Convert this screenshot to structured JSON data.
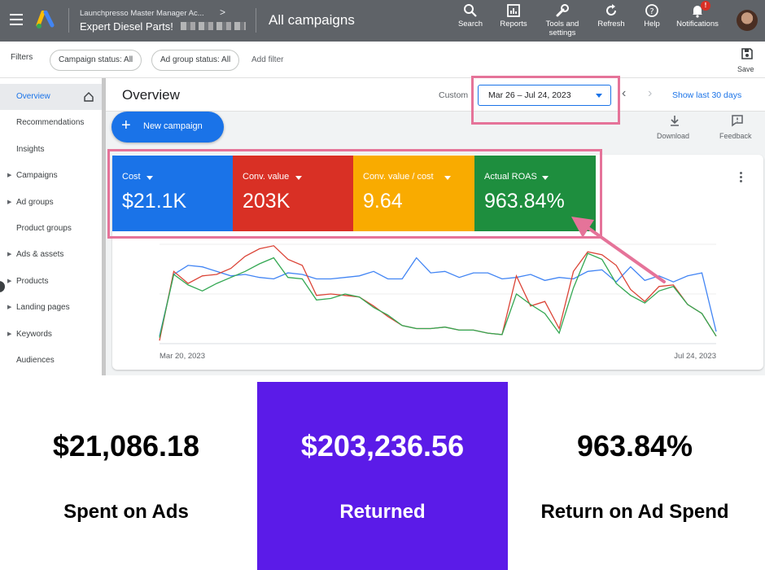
{
  "topbar": {
    "account_path": "Launchpresso Master Manager Ac...",
    "account_name": "Expert Diesel Parts!",
    "page_title": "All campaigns",
    "tools": [
      {
        "icon": "search-icon",
        "label": "Search"
      },
      {
        "icon": "reports-icon",
        "label": "Reports"
      },
      {
        "icon": "wrench-icon",
        "label": "Tools and\nsettings"
      },
      {
        "icon": "refresh-icon",
        "label": "Refresh"
      },
      {
        "icon": "help-icon",
        "label": "Help"
      },
      {
        "icon": "bell-icon",
        "label": "Notifications"
      }
    ],
    "notification_badge": "!"
  },
  "filters": {
    "label": "Filters",
    "campaign_status": "Campaign status: All",
    "ad_group_status": "Ad group status: All",
    "add_filter": "Add filter",
    "save_label": "Save"
  },
  "sidebar": {
    "items": [
      {
        "label": "Overview",
        "active": true,
        "caret": false
      },
      {
        "label": "Recommendations",
        "active": false,
        "caret": false
      },
      {
        "label": "Insights",
        "active": false,
        "caret": false
      },
      {
        "label": "Campaigns",
        "active": false,
        "caret": true
      },
      {
        "label": "Ad groups",
        "active": false,
        "caret": true
      },
      {
        "label": "Product groups",
        "active": false,
        "caret": false
      },
      {
        "label": "Ads & assets",
        "active": false,
        "caret": true
      },
      {
        "label": "Products",
        "active": false,
        "caret": true
      },
      {
        "label": "Landing pages",
        "active": false,
        "caret": true
      },
      {
        "label": "Keywords",
        "active": false,
        "caret": true
      },
      {
        "label": "Audiences",
        "active": false,
        "caret": false
      }
    ]
  },
  "overview": {
    "title": "Overview",
    "custom_label": "Custom",
    "date_range": "Mar 26 – Jul 24, 2023",
    "show_last": "Show last 30 days",
    "new_campaign": "New campaign",
    "download": "Download",
    "feedback": "Feedback"
  },
  "kpis": [
    {
      "label": "Cost",
      "value": "$21.1K",
      "color": "#1a73e8"
    },
    {
      "label": "Conv. value",
      "value": "203K",
      "color": "#d93025"
    },
    {
      "label": "Conv. value / cost",
      "value": "9.64",
      "color": "#f9ab00"
    },
    {
      "label": "Actual ROAS",
      "value": "963.84%",
      "color": "#1e8e3e"
    }
  ],
  "highlight_color": "#e57399",
  "chart_data": {
    "type": "line",
    "x_start_label": "Mar 20, 2023",
    "x_end_label": "Jul 24, 2023",
    "series": [
      {
        "color": "#4285f4",
        "values": [
          5,
          46,
          52,
          51,
          48,
          45,
          46,
          44,
          43,
          47,
          46,
          43,
          43,
          44,
          45,
          48,
          43,
          43,
          57,
          47,
          48,
          44,
          47,
          47,
          43,
          44,
          46,
          42,
          44,
          43,
          48,
          49,
          41,
          51,
          42,
          45,
          41,
          45,
          47,
          8
        ]
      },
      {
        "color": "#db4437",
        "values": [
          2,
          48,
          40,
          45,
          46,
          50,
          58,
          63,
          65,
          56,
          52,
          32,
          33,
          32,
          31,
          25,
          18,
          12,
          10,
          10,
          11,
          9,
          9,
          7,
          6,
          45,
          25,
          28,
          10,
          48,
          61,
          59,
          52,
          36,
          28,
          38,
          39,
          26,
          20,
          5
        ]
      },
      {
        "color": "#34a853",
        "values": [
          4,
          46,
          39,
          35,
          40,
          44,
          48,
          53,
          57,
          44,
          43,
          29,
          30,
          33,
          31,
          24,
          19,
          12,
          10,
          10,
          11,
          9,
          9,
          7,
          6,
          33,
          26,
          20,
          7,
          37,
          60,
          56,
          40,
          32,
          27,
          35,
          38,
          26,
          20,
          5
        ]
      }
    ]
  },
  "stats": [
    {
      "value": "$21,086.18",
      "caption": "Spent on Ads"
    },
    {
      "value": "$203,236.56",
      "caption": "Returned"
    },
    {
      "value": "963.84%",
      "caption": "Return on Ad Spend"
    }
  ],
  "colors": {
    "topbar": "#5f6368",
    "returned_panel": "#5b1be8",
    "accent_blue": "#1a73e8"
  }
}
